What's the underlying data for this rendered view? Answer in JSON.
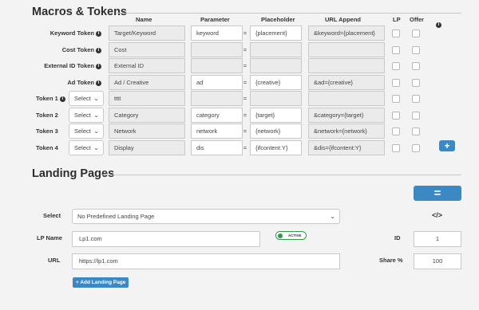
{
  "macros": {
    "title": "Macros & Tokens",
    "columns": {
      "name": "Name",
      "parameter": "Parameter",
      "placeholder": "Placeholder",
      "url_append": "URL Append",
      "lp": "LP",
      "offer": "Offer"
    },
    "eq_sign": "=",
    "select_label": "Select",
    "rows": [
      {
        "label": "Keyword Token",
        "name": "Target/Keyword",
        "parameter": "keyword",
        "placeholder": "{placement}",
        "url_append": "&keyword={placement}"
      },
      {
        "label": "Cost Token",
        "name": "Cost",
        "parameter": "",
        "placeholder": "",
        "url_append": ""
      },
      {
        "label": "External ID Token",
        "name": "External ID",
        "parameter": "",
        "placeholder": "",
        "url_append": ""
      },
      {
        "label": "Ad Token",
        "name": "Ad / Creative",
        "parameter": "ad",
        "placeholder": "{creative}",
        "url_append": "&ad={creative}"
      },
      {
        "label": "Token 1",
        "name": "tttt",
        "parameter": "",
        "placeholder": "",
        "url_append": ""
      },
      {
        "label": "Token 2",
        "name": "Category",
        "parameter": "category",
        "placeholder": "{target}",
        "url_append": "&category={target}"
      },
      {
        "label": "Token 3",
        "name": "Network",
        "parameter": "network",
        "placeholder": "{network}",
        "url_append": "&network={network}"
      },
      {
        "label": "Token 4",
        "name": "Display",
        "parameter": "dis",
        "placeholder": "{ifcontent:Y}",
        "url_append": "&dis={ifcontent:Y}"
      }
    ],
    "add_button": "+"
  },
  "landing": {
    "title": "Landing Pages",
    "distribute_button": "=",
    "select_label": "Select",
    "select_value": "No Predefined Landing Page",
    "lp_name_label": "LP Name",
    "lp_name_value": "Lp1.com",
    "active_label": "ACTIVE",
    "url_label": "URL",
    "url_value": "https://lp1.com",
    "id_label": "ID",
    "id_value": "1",
    "share_label": "Share %",
    "share_value": "100",
    "code_icon": "</>",
    "add_button": "+ Add Landing Page"
  },
  "icons": {
    "info": "i",
    "chevron": "⌄"
  },
  "colors": {
    "accent": "#3b88c3",
    "active": "#2e9b4a",
    "readonly_bg": "#ebebeb"
  }
}
